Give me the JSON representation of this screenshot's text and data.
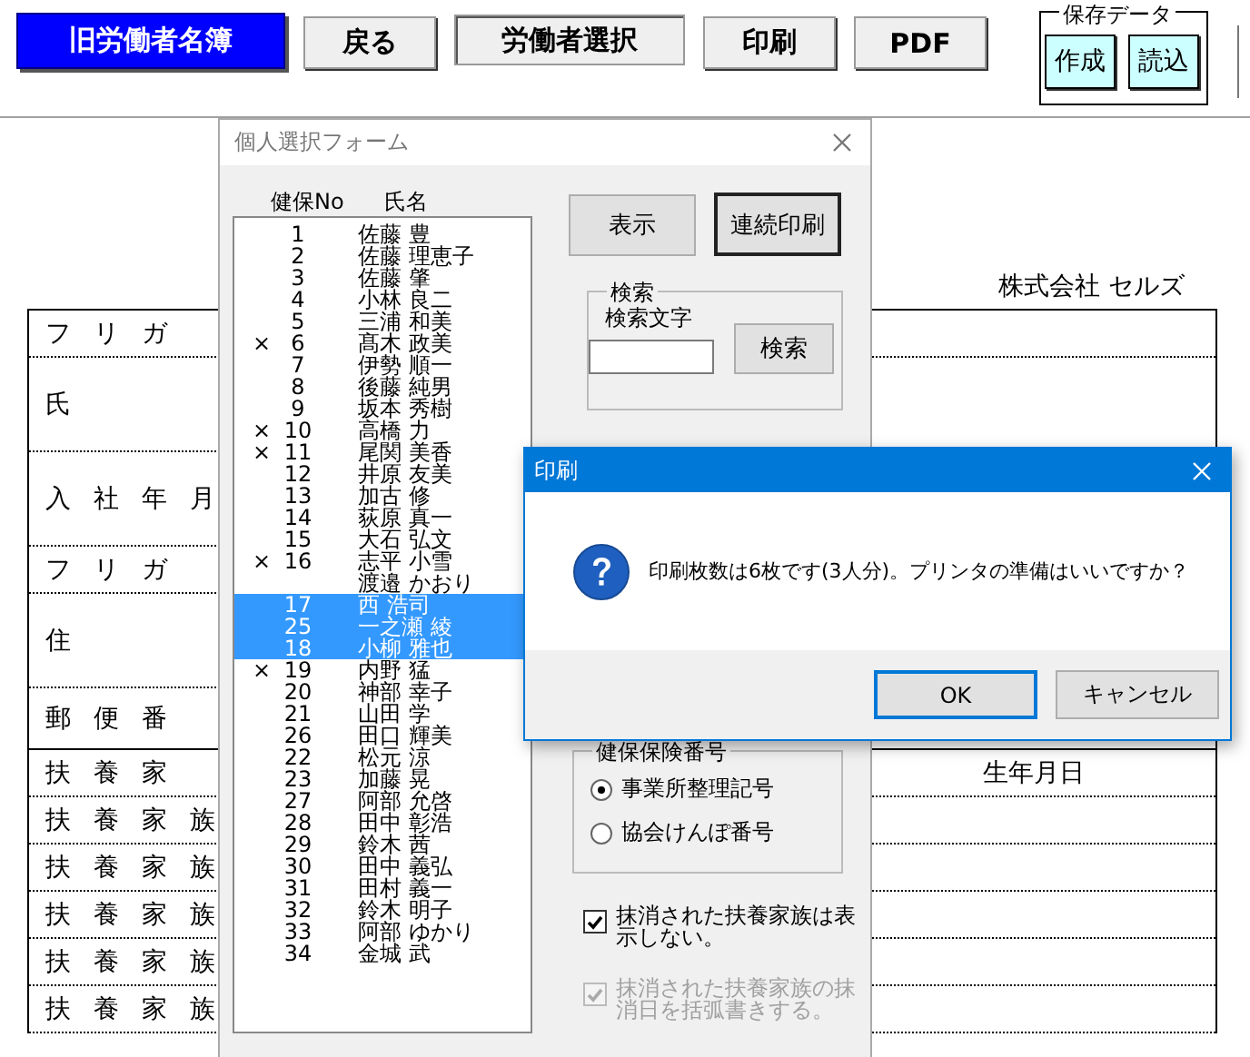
{
  "toolbar": {
    "buttons": [
      {
        "label": "旧労働者名簿",
        "kind": "primary"
      },
      {
        "label": "戻る",
        "kind": "normal"
      },
      {
        "label": "労働者選択",
        "kind": "pressed"
      },
      {
        "label": "印刷",
        "kind": "normal"
      },
      {
        "label": "PDF",
        "kind": "normal"
      }
    ],
    "save_group": {
      "title": "保存データ",
      "buttons": [
        "作成",
        "読込"
      ]
    }
  },
  "sheet": {
    "company": "株式会社 セルズ",
    "rows": [
      {
        "label": "フ リ ガ",
        "kind": "short"
      },
      {
        "label": "氏",
        "kind": "tall"
      },
      {
        "label": "入 社 年 月",
        "kind": "tall"
      },
      {
        "label": "フ リ ガ",
        "kind": "short"
      },
      {
        "label": "住",
        "kind": "tall"
      },
      {
        "label": "郵 便 番",
        "kind": "postal"
      },
      {
        "label": "扶 養 家",
        "kind": "header",
        "birth_date": "生年月日"
      },
      {
        "label": "扶 養 家 族",
        "kind": "dependent"
      },
      {
        "label": "扶 養 家 族",
        "kind": "dependent"
      },
      {
        "label": "扶 養 家 族",
        "kind": "dependent"
      },
      {
        "label": "扶 養 家 族",
        "kind": "dependent"
      },
      {
        "label": "扶 養 家 族",
        "kind": "dependent"
      }
    ]
  },
  "selection_dialog": {
    "title": "個人選択フォーム",
    "columns": [
      "健保No",
      "氏名"
    ],
    "rows": [
      {
        "no": "1",
        "name": "佐藤 豊",
        "selected": false
      },
      {
        "no": "2",
        "name": "佐藤 理恵子",
        "selected": false
      },
      {
        "no": "3",
        "name": "佐藤 肇",
        "selected": false
      },
      {
        "no": "4",
        "name": "小林 良二",
        "selected": false
      },
      {
        "no": "5",
        "name": "三浦 和美",
        "selected": false
      },
      {
        "mark": "×",
        "no": "6",
        "name": "髙木 政美",
        "selected": false
      },
      {
        "no": "7",
        "name": "伊勢 順一",
        "selected": false
      },
      {
        "no": "8",
        "name": "後藤 純男",
        "selected": false
      },
      {
        "no": "9",
        "name": "坂本 秀樹",
        "selected": false
      },
      {
        "mark": "×",
        "no": "10",
        "name": "高橋 力",
        "selected": false
      },
      {
        "mark": "×",
        "no": "11",
        "name": "尾関 美香",
        "selected": false
      },
      {
        "no": "12",
        "name": "井原 友美",
        "selected": false
      },
      {
        "no": "13",
        "name": "加古 修",
        "selected": false
      },
      {
        "no": "14",
        "name": "荻原 真一",
        "selected": false
      },
      {
        "no": "15",
        "name": "大石 弘文",
        "selected": false
      },
      {
        "mark": "×",
        "no": "16",
        "name": "志平 小雪",
        "selected": false
      },
      {
        "name": "渡邉 かおり",
        "selected": false
      },
      {
        "no": "17",
        "name": "西 浩司",
        "selected": true
      },
      {
        "no": "25",
        "name": "一之瀬 綾",
        "selected": true
      },
      {
        "no": "18",
        "name": "小柳 雅也",
        "selected": true
      },
      {
        "mark": "×",
        "no": "19",
        "name": "内野 猛",
        "selected": false
      },
      {
        "no": "20",
        "name": "神部 幸子",
        "selected": false
      },
      {
        "no": "21",
        "name": "山田 学",
        "selected": false
      },
      {
        "no": "26",
        "name": "田口 輝美",
        "selected": false
      },
      {
        "no": "22",
        "name": "松元 涼",
        "selected": false
      },
      {
        "no": "23",
        "name": "加藤 晃",
        "selected": false
      },
      {
        "no": "27",
        "name": "阿部 允啓",
        "selected": false
      },
      {
        "no": "28",
        "name": "田中 彰浩",
        "selected": false
      },
      {
        "no": "29",
        "name": "鈴木 茜",
        "selected": false
      },
      {
        "no": "30",
        "name": "田中 義弘",
        "selected": false
      },
      {
        "no": "31",
        "name": "田村 義一",
        "selected": false
      },
      {
        "no": "32",
        "name": "鈴木 明子",
        "selected": false
      },
      {
        "no": "33",
        "name": "阿部 ゆかり",
        "selected": false
      },
      {
        "no": "34",
        "name": "金城 武",
        "selected": false
      }
    ],
    "show_button": "表示",
    "batch_print_button": "連続印刷",
    "search": {
      "title": "検索",
      "field_label": "検索文字",
      "button": "検索"
    },
    "insurance_number": {
      "title": "健保保険番号",
      "options": [
        {
          "label": "事業所整理記号",
          "selected": true
        },
        {
          "label": "協会けんぽ番号",
          "selected": false
        }
      ]
    },
    "options": [
      {
        "label": "抹消された扶養家族は表示しない。",
        "checked": true,
        "disabled": false
      },
      {
        "label": "抹消された扶養家族の抹消日を括弧書きする。",
        "checked": true,
        "disabled": true
      }
    ]
  },
  "print_dialog": {
    "title": "印刷",
    "message": "印刷枚数は6枚です(3人分)。プリンタの準備はいいですか？",
    "buttons": [
      {
        "label": "OK",
        "kind": "default"
      },
      {
        "label": "キャンセル",
        "kind": "normal"
      }
    ]
  }
}
